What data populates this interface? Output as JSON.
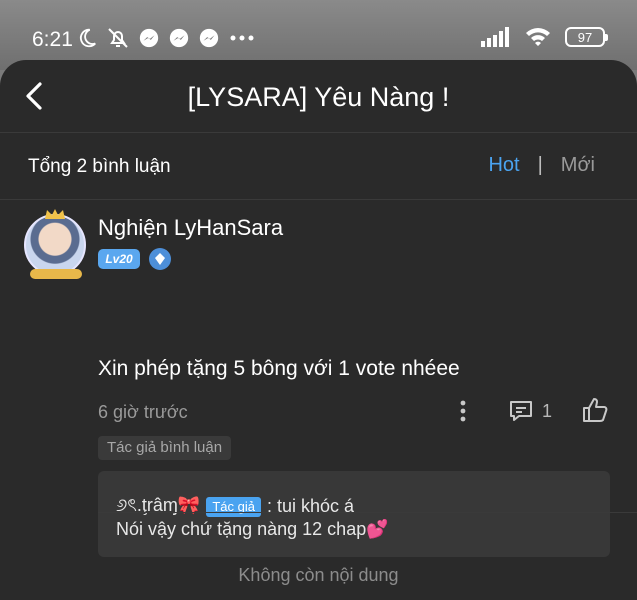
{
  "status_bar": {
    "time": "6:21",
    "battery": "97",
    "icons": [
      "moon-icon",
      "bell-off-icon",
      "messenger-icon",
      "messenger-icon",
      "messenger-icon",
      "more-dots-icon",
      "signal-icon",
      "wifi-icon",
      "battery-icon"
    ]
  },
  "header": {
    "title": "[LYSARA] Yêu Nàng !",
    "back_icon": "chevron-left-icon"
  },
  "comments_bar": {
    "total_label": "Tổng 2 bình luận",
    "sort_hot": "Hot",
    "separator": "|",
    "sort_new": "Mới"
  },
  "comment": {
    "username": "Nghiện LyHanSara",
    "level": "Lv20",
    "content": "Xin phép tặng 5 bông với 1 vote nhéee",
    "time": "6 giờ trước",
    "reply_count": "1",
    "author_tag": "Tác giả bình luận",
    "reply": {
      "name": "୬ৎ.ţrâɱ🎀",
      "author_badge": "Tác giả",
      "text": ": tui khóc á",
      "line2": "Nói vậy chứ tặng nàng 12 chap💕"
    }
  },
  "footer": {
    "no_more": "Không còn nội dung"
  },
  "colors": {
    "accent": "#4aa3f0",
    "background": "#2a2a2a",
    "reply_box": "#383838"
  }
}
